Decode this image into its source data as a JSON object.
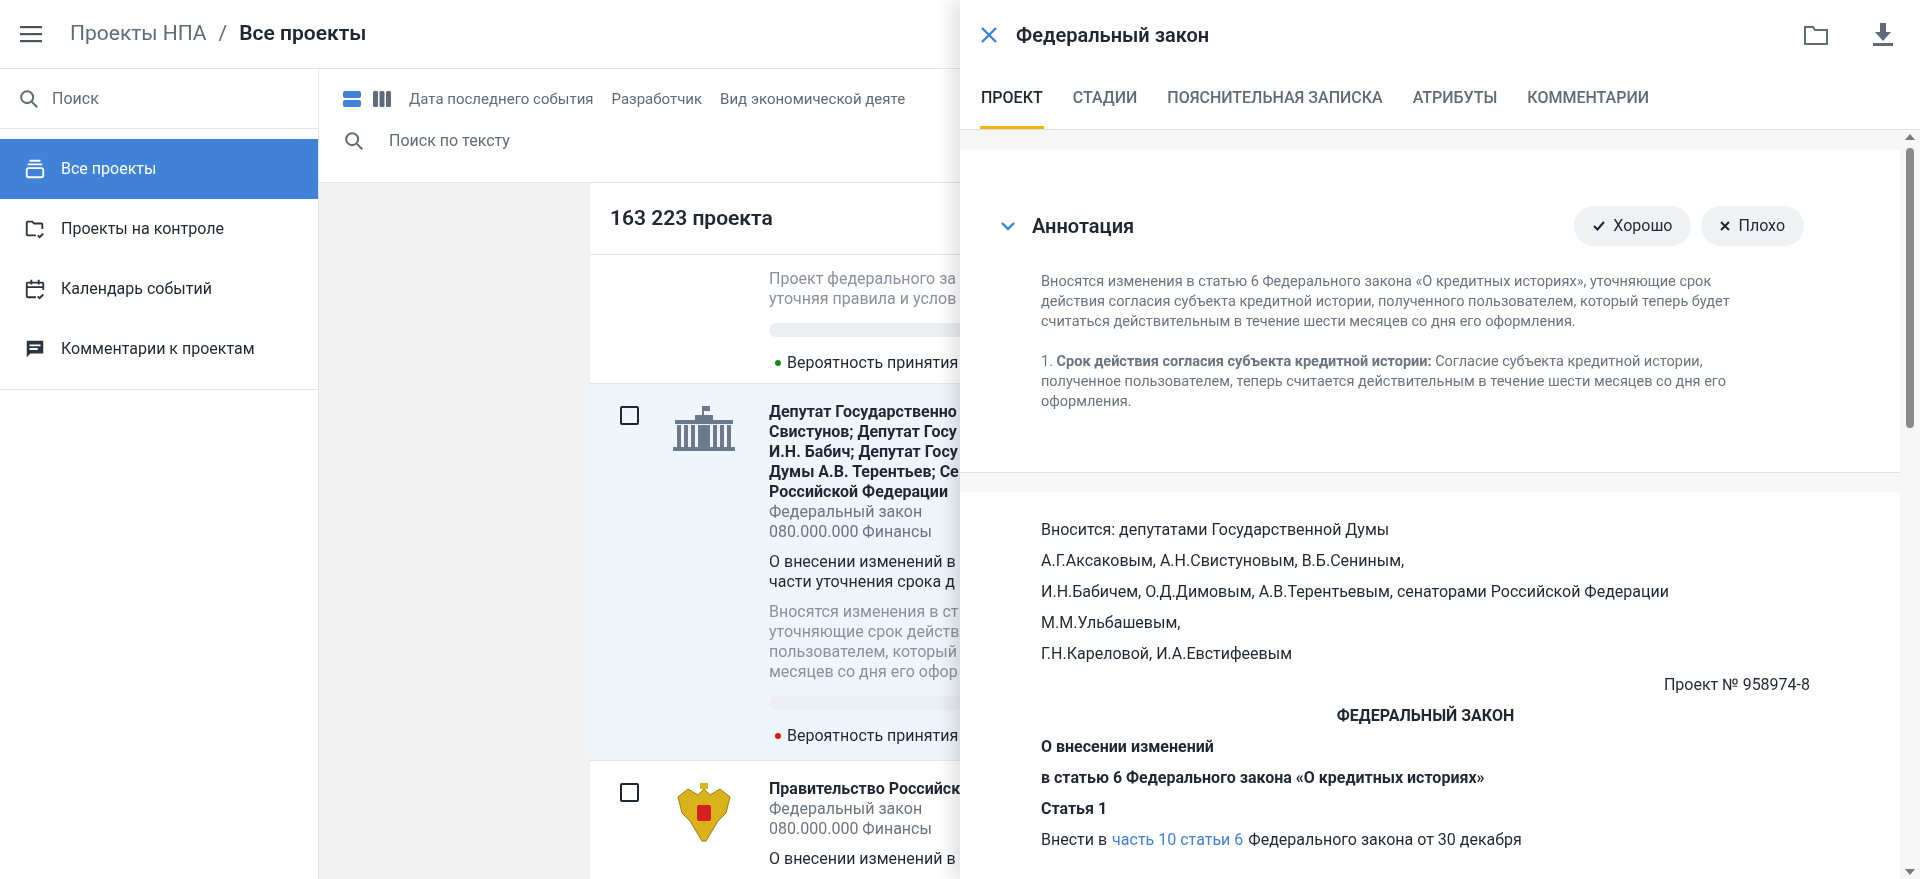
{
  "header": {
    "breadcrumb": [
      {
        "label": "Проекты НПА",
        "current": false
      },
      {
        "label": "/",
        "current": false
      },
      {
        "label": "Все проекты",
        "current": true
      }
    ]
  },
  "sidebar": {
    "search_placeholder": "Поиск",
    "items": [
      {
        "label": "Все проекты",
        "kind": "stack",
        "selected": true
      },
      {
        "label": "Проекты на контроле",
        "kind": "folder-check",
        "selected": false
      },
      {
        "label": "Календарь событий",
        "kind": "calendar",
        "selected": false
      },
      {
        "label": "Комментарии к проектам",
        "kind": "comment",
        "selected": false
      }
    ]
  },
  "toolbar": {
    "views": [
      {
        "kind": "rows",
        "selected": true
      },
      {
        "kind": "columns",
        "selected": false
      }
    ],
    "filters": [
      "Дата последнего события",
      "Разработчик",
      "Вид экономической деяте"
    ],
    "search_placeholder": "Поиск по тексту"
  },
  "list": {
    "count": "163 223 проекта",
    "items": [
      {
        "selected": false,
        "description": [
          "Проект федерального за",
          "уточняя правила и услов"
        ],
        "probability": {
          "label": "Вероятность принятия",
          "color": "#1a8a1a"
        }
      },
      {
        "selected": true,
        "checked": false,
        "kind": "building",
        "title": [
          "Депутат Государственно",
          "Свистунов; Депутат Госу",
          "И.Н. Бабич; Депутат Госу",
          "Думы А.В. Терентьев; Се",
          "Российской Федерации"
        ],
        "type": "Федеральный закон",
        "category": "080.000.000 Финансы",
        "summary": [
          "О внесении изменений в",
          "части уточнения срока д"
        ],
        "description": [
          "Вносятся изменения в ст",
          "уточняющие срок действ",
          "пользователем, который",
          "месяцев со дня его офор"
        ],
        "probability": {
          "label": "Вероятность принятия",
          "color": "#e81010"
        }
      },
      {
        "selected": false,
        "checked": false,
        "kind": "emblem",
        "title": [
          "Правительство Российск"
        ],
        "type": "Федеральный закон",
        "category": "080.000.000 Финансы",
        "summary": [
          "О внесении изменений в"
        ]
      }
    ]
  },
  "panel": {
    "title": "Федеральный закон",
    "tabs": [
      {
        "label": "ПРОЕКТ",
        "selected": true
      },
      {
        "label": "СТАДИИ",
        "selected": false
      },
      {
        "label": "ПОЯСНИТЕЛЬНАЯ ЗАПИСКА",
        "selected": false
      },
      {
        "label": "АТРИБУТЫ",
        "selected": false
      },
      {
        "label": "КОММЕНТАРИИ",
        "selected": false
      }
    ],
    "annotation": {
      "title": "Аннотация",
      "expanded": true,
      "buttons": [
        {
          "label": "Хорошо",
          "kind": "good"
        },
        {
          "label": "Плохо",
          "kind": "bad"
        }
      ],
      "paragraphs": [
        "Вносятся изменения в статью 6 Федерального закона «О кредитных историях», уточняющие срок действия согласия субъекта кредитной истории, полученного пользователем, который теперь будет считаться действительным в течение шести месяцев со дня его оформления.",
        "1. **Срок действия согласия субъекта кредитной истории:** Согласие субъекта кредитной истории, полученное пользователем, теперь считается действительным в течение шести месяцев со дня его оформления."
      ]
    },
    "document": [
      {
        "kind": "plain",
        "text": "Вносится: депутатами Государственной Думы"
      },
      {
        "kind": "plain",
        "text": "А.Г.Аксаковым, А.Н.Свистуновым, В.Б.Сениным,"
      },
      {
        "kind": "plain",
        "text": "И.Н.Бабичем, О.Д.Димовым, А.В.Терентьевым, сенаторами Российской Федерации"
      },
      {
        "kind": "plain",
        "text": "М.М.Ульбашевым,"
      },
      {
        "kind": "plain",
        "text": "Г.Н.Кареловой, И.А.Евстифеевым"
      },
      {
        "kind": "right",
        "text": "Проект № 958974-8"
      },
      {
        "kind": "center-bold",
        "text": "ФЕДЕРАЛЬНЫЙ ЗАКОН"
      },
      {
        "kind": "bold",
        "text": "О внесении изменений"
      },
      {
        "kind": "bold",
        "text": "в статью 6 Федерального закона «О кредитных историях»"
      },
      {
        "kind": "bold",
        "text": "Статья 1"
      },
      {
        "kind": "link",
        "before": "Внести в",
        "link": "часть 10 статьи 6",
        "after": "Федерального закона от 30 декабря"
      }
    ]
  }
}
